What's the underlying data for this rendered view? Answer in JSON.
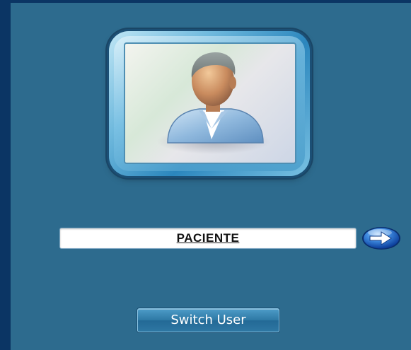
{
  "login": {
    "username": "PACIENTE",
    "avatar_icon": "user-avatar-icon",
    "go_icon": "right-arrow-icon"
  },
  "actions": {
    "switch_user_label": "Switch User"
  },
  "colors": {
    "background": "#2d6b8e",
    "border": "#0b3564",
    "button": "#2f7aa6"
  }
}
